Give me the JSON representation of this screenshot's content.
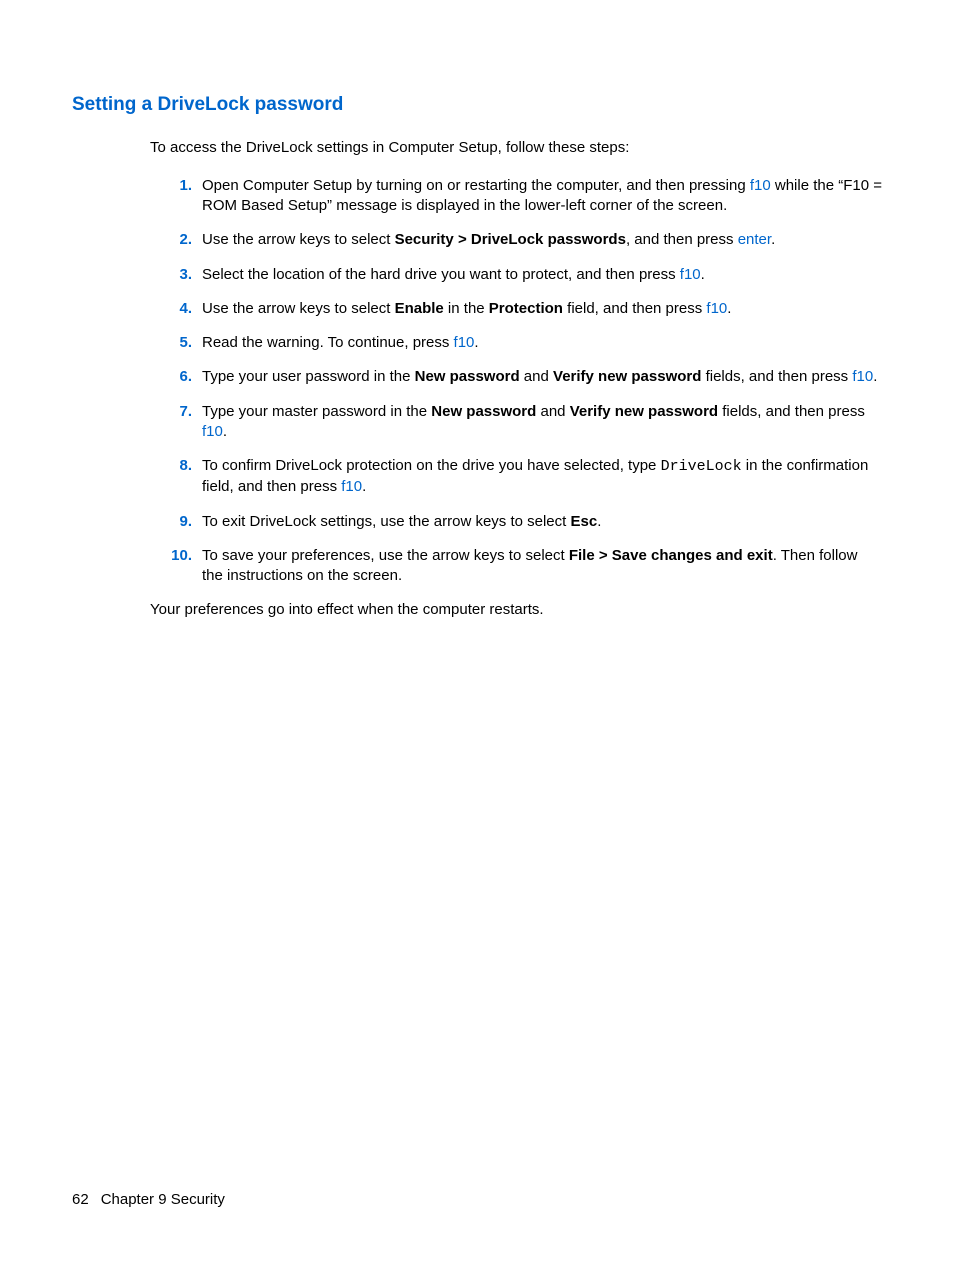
{
  "heading": "Setting a DriveLock password",
  "intro": "To access the DriveLock settings in Computer Setup, follow these steps:",
  "steps": {
    "n1": "1.",
    "s1a": "Open Computer Setup by turning on or restarting the computer, and then pressing ",
    "s1k": "f10",
    "s1b": " while the “F10 = ROM Based Setup” message is displayed in the lower-left corner of the screen.",
    "n2": "2.",
    "s2a": "Use the arrow keys to select ",
    "s2b": "Security > DriveLock passwords",
    "s2c": ", and then press ",
    "s2k": "enter",
    "s2d": ".",
    "n3": "3.",
    "s3a": "Select the location of the hard drive you want to protect, and then press ",
    "s3k": "f10",
    "s3b": ".",
    "n4": "4.",
    "s4a": "Use the arrow keys to select ",
    "s4b": "Enable",
    "s4c": " in the ",
    "s4d": "Protection",
    "s4e": " field, and then press ",
    "s4k": "f10",
    "s4f": ".",
    "n5": "5.",
    "s5a": "Read the warning. To continue, press ",
    "s5k": "f10",
    "s5b": ".",
    "n6": "6.",
    "s6a": "Type your user password in the ",
    "s6b": "New password",
    "s6c": " and ",
    "s6d": "Verify new password",
    "s6e": " fields, and then press ",
    "s6k": "f10",
    "s6f": ".",
    "n7": "7.",
    "s7a": "Type your master password in the ",
    "s7b": "New password",
    "s7c": " and ",
    "s7d": "Verify new password",
    "s7e": " fields, and then press ",
    "s7k": "f10",
    "s7f": ".",
    "n8": "8.",
    "s8a": "To confirm DriveLock protection on the drive you have selected, type ",
    "s8m": "DriveLock",
    "s8b": " in the confirmation field, and then press ",
    "s8k": "f10",
    "s8c": ".",
    "n9": "9.",
    "s9a": "To exit DriveLock settings, use the arrow keys to select ",
    "s9b": "Esc",
    "s9c": ".",
    "n10": "10.",
    "s10a": "To save your preferences, use the arrow keys to select ",
    "s10b": "File > Save changes and exit",
    "s10c": ". Then follow the instructions on the screen."
  },
  "outro": "Your preferences go into effect when the computer restarts.",
  "footer": {
    "page": "62",
    "chapter": "Chapter 9   Security"
  }
}
